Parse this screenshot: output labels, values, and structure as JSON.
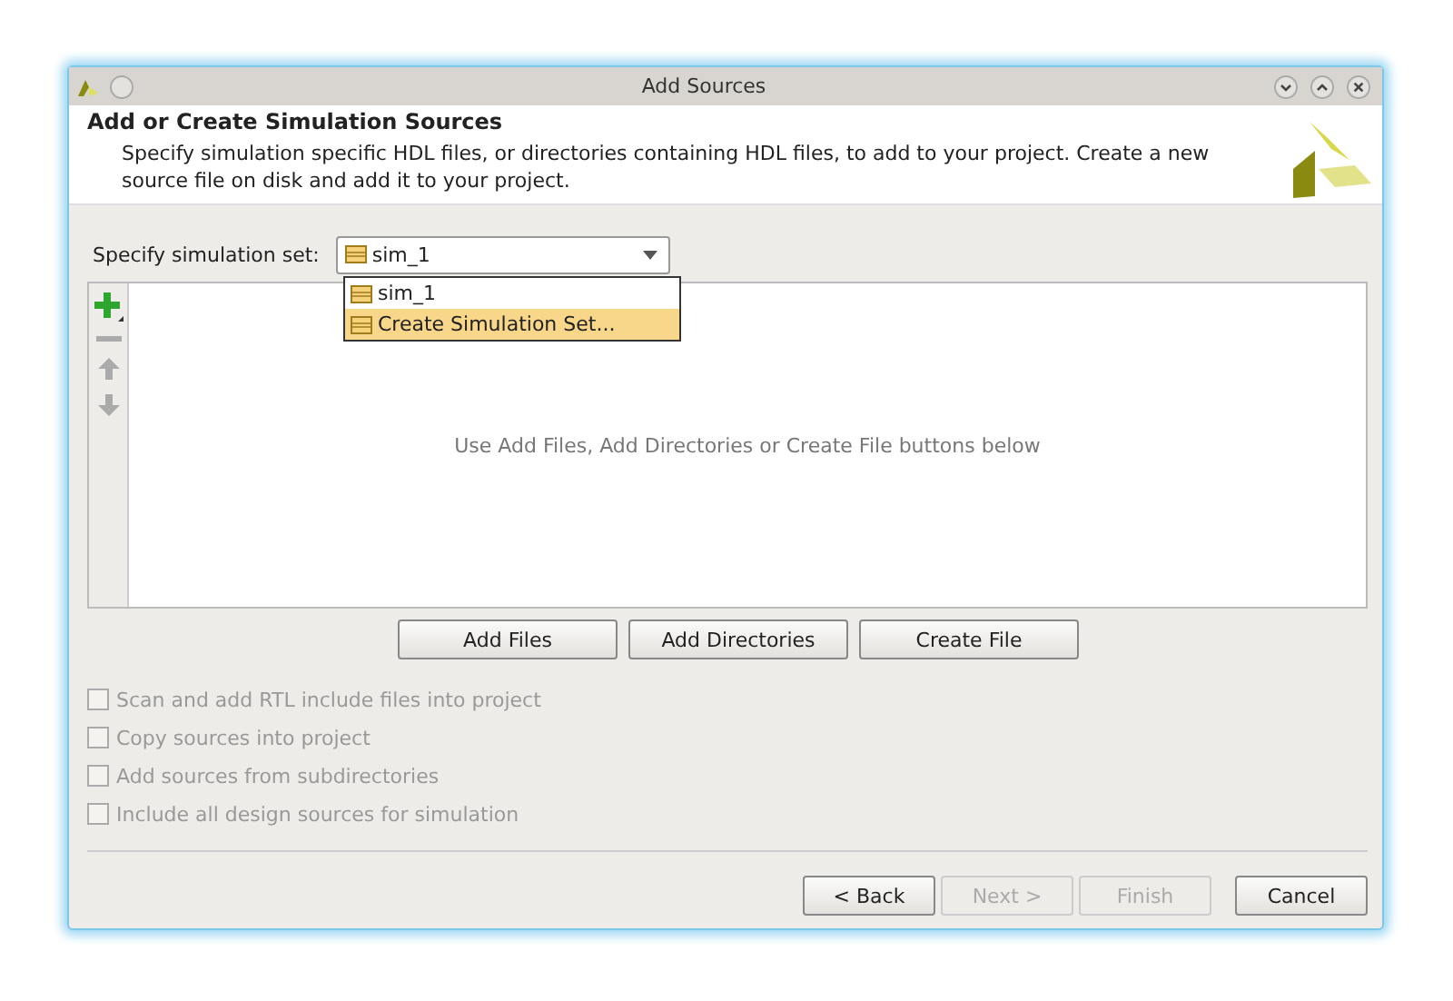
{
  "window": {
    "title": "Add Sources"
  },
  "header": {
    "title": "Add or Create Simulation Sources",
    "description": "Specify simulation specific HDL files, or directories containing HDL files, to add to your project. Create a new source file on disk and add it to your project."
  },
  "simulation_set": {
    "label": "Specify simulation set:",
    "value": "sim_1",
    "options": [
      {
        "label": "sim_1",
        "highlighted": false
      },
      {
        "label": "Create Simulation Set...",
        "highlighted": true
      }
    ]
  },
  "file_list": {
    "placeholder": "Use Add Files, Add Directories or Create File buttons below"
  },
  "list_buttons": [
    "Add Files",
    "Add Directories",
    "Create File"
  ],
  "options": [
    {
      "label": "Scan and add RTL include files into project",
      "checked": false,
      "disabled": true
    },
    {
      "label": "Copy sources into project",
      "checked": false,
      "disabled": true
    },
    {
      "label": "Add sources from subdirectories",
      "checked": false,
      "disabled": true
    },
    {
      "label": "Include all design sources for simulation",
      "checked": false,
      "disabled": true
    }
  ],
  "footer_buttons": [
    {
      "label": "< Back",
      "disabled": false
    },
    {
      "label": "Next >",
      "disabled": true
    },
    {
      "label": "Finish",
      "disabled": true
    },
    {
      "label": "Cancel",
      "disabled": false
    }
  ]
}
